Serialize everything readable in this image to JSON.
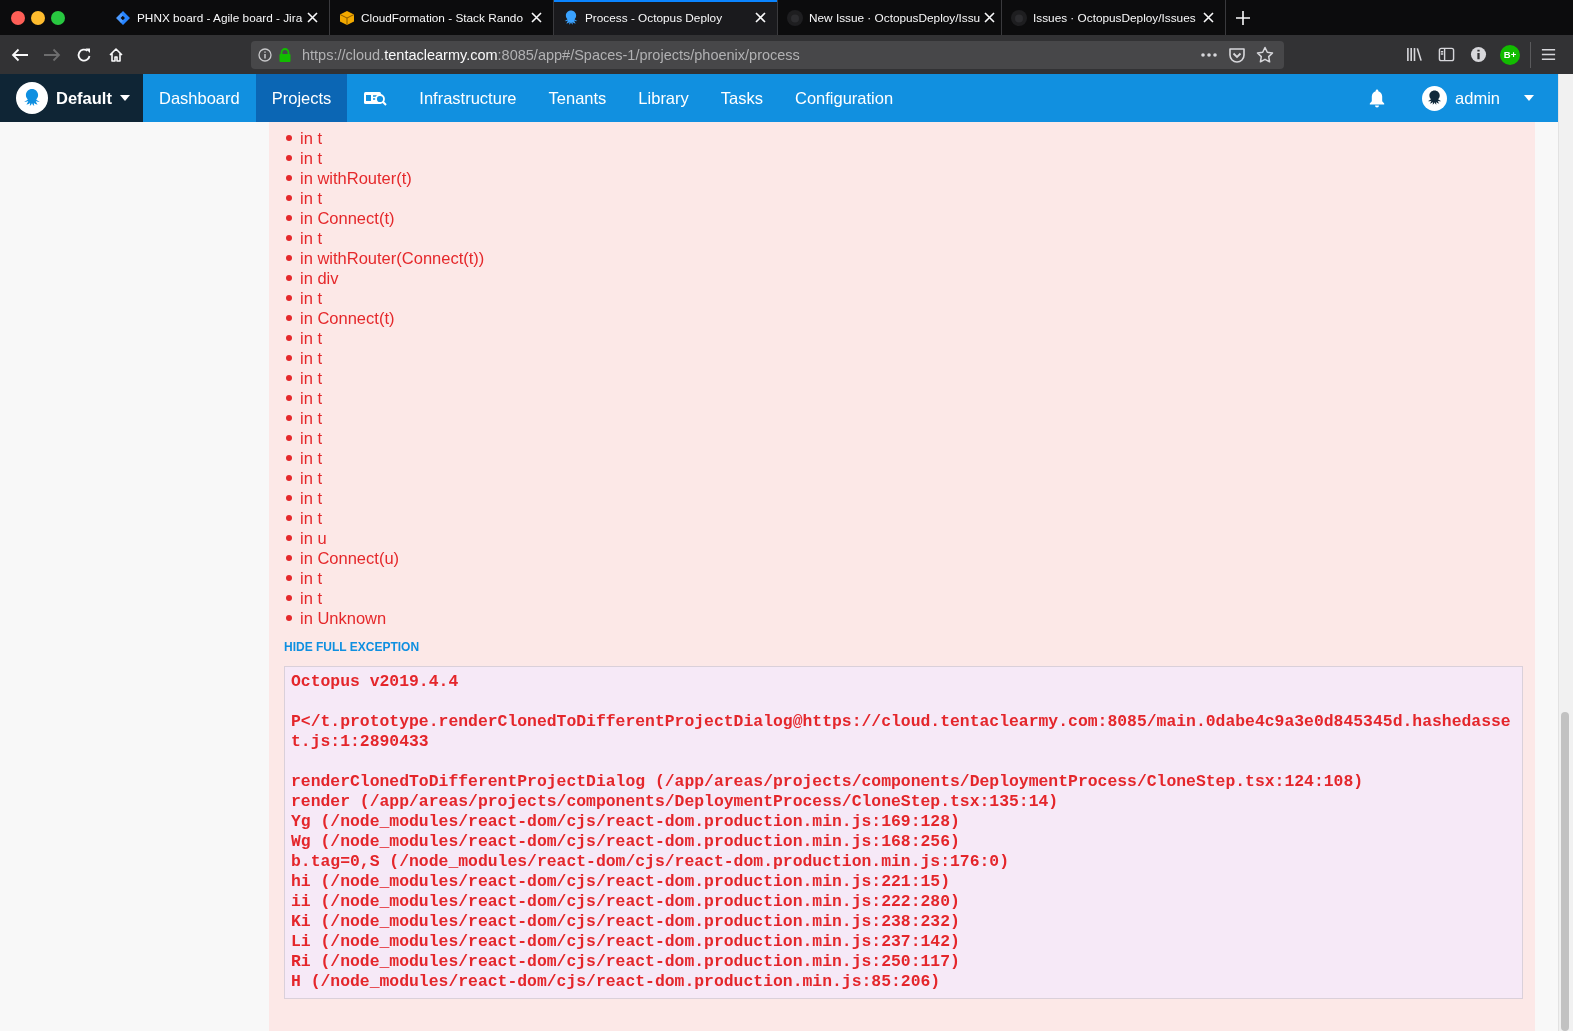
{
  "browser": {
    "tabs": [
      {
        "title": "PHNX board - Agile board - Jira",
        "selected": false
      },
      {
        "title": "CloudFormation - Stack Rando",
        "selected": false
      },
      {
        "title": "Process - Octopus Deploy",
        "selected": true
      },
      {
        "title": "New Issue · OctopusDeploy/Issu",
        "selected": false
      },
      {
        "title": "Issues · OctopusDeploy/Issues",
        "selected": false
      }
    ],
    "back_button": {
      "disabled": false
    },
    "forward_button": {
      "disabled": true
    },
    "url": "https://cloud.**tentaclearmy.com**:8085/app#/Spaces-1/projects/phoenix/process",
    "extension_badge": "B+"
  },
  "nav": {
    "space": "Default",
    "items": [
      {
        "kind": "link",
        "label": "Dashboard",
        "selected": false
      },
      {
        "kind": "link",
        "label": "Projects",
        "selected": true
      },
      {
        "kind": "icon",
        "selected": false
      },
      {
        "kind": "link",
        "label": "Infrastructure",
        "selected": false
      },
      {
        "kind": "link",
        "label": "Tenants",
        "selected": false
      },
      {
        "kind": "link",
        "label": "Library",
        "selected": false
      },
      {
        "kind": "link",
        "label": "Tasks",
        "selected": false
      },
      {
        "kind": "link",
        "label": "Configuration",
        "selected": false
      }
    ],
    "user": "admin"
  },
  "error": {
    "component_stack": [
      "in t",
      "in t",
      "in withRouter(t)",
      "in t",
      "in Connect(t)",
      "in t",
      "in withRouter(Connect(t))",
      "in div",
      "in t",
      "in Connect(t)",
      "in t",
      "in t",
      "in t",
      "in t",
      "in t",
      "in t",
      "in t",
      "in t",
      "in t",
      "in t",
      "in u",
      "in Connect(u)",
      "in t",
      "in t",
      "in Unknown"
    ],
    "toggle_label": "HIDE FULL EXCEPTION",
    "details": [
      [
        "Octopus v2019.4.4"
      ],
      [
        "P</t.prototype.renderClonedToDifferentProjectDialog@https://cloud.tentaclearmy.com:8085/main.0dabe4c9a3e0d845345d.hashedasset.js:1:2890433"
      ],
      [
        "renderClonedToDifferentProjectDialog (/app/areas/projects/components/DeploymentProcess/CloneStep.tsx:124:108)",
        "render (/app/areas/projects/components/DeploymentProcess/CloneStep.tsx:135:14)",
        "Yg (/node_modules/react-dom/cjs/react-dom.production.min.js:169:128)",
        "Wg (/node_modules/react-dom/cjs/react-dom.production.min.js:168:256)",
        "b.tag=0,S (/node_modules/react-dom/cjs/react-dom.production.min.js:176:0)",
        "hi (/node_modules/react-dom/cjs/react-dom.production.min.js:221:15)",
        "ii (/node_modules/react-dom/cjs/react-dom.production.min.js:222:280)",
        "Ki (/node_modules/react-dom/cjs/react-dom.production.min.js:238:232)",
        "Li (/node_modules/react-dom/cjs/react-dom.production.min.js:237:142)",
        "Ri (/node_modules/react-dom/cjs/react-dom.production.min.js:250:117)",
        "H (/node_modules/react-dom/cjs/react-dom.production.min.js:85:206)"
      ]
    ]
  }
}
